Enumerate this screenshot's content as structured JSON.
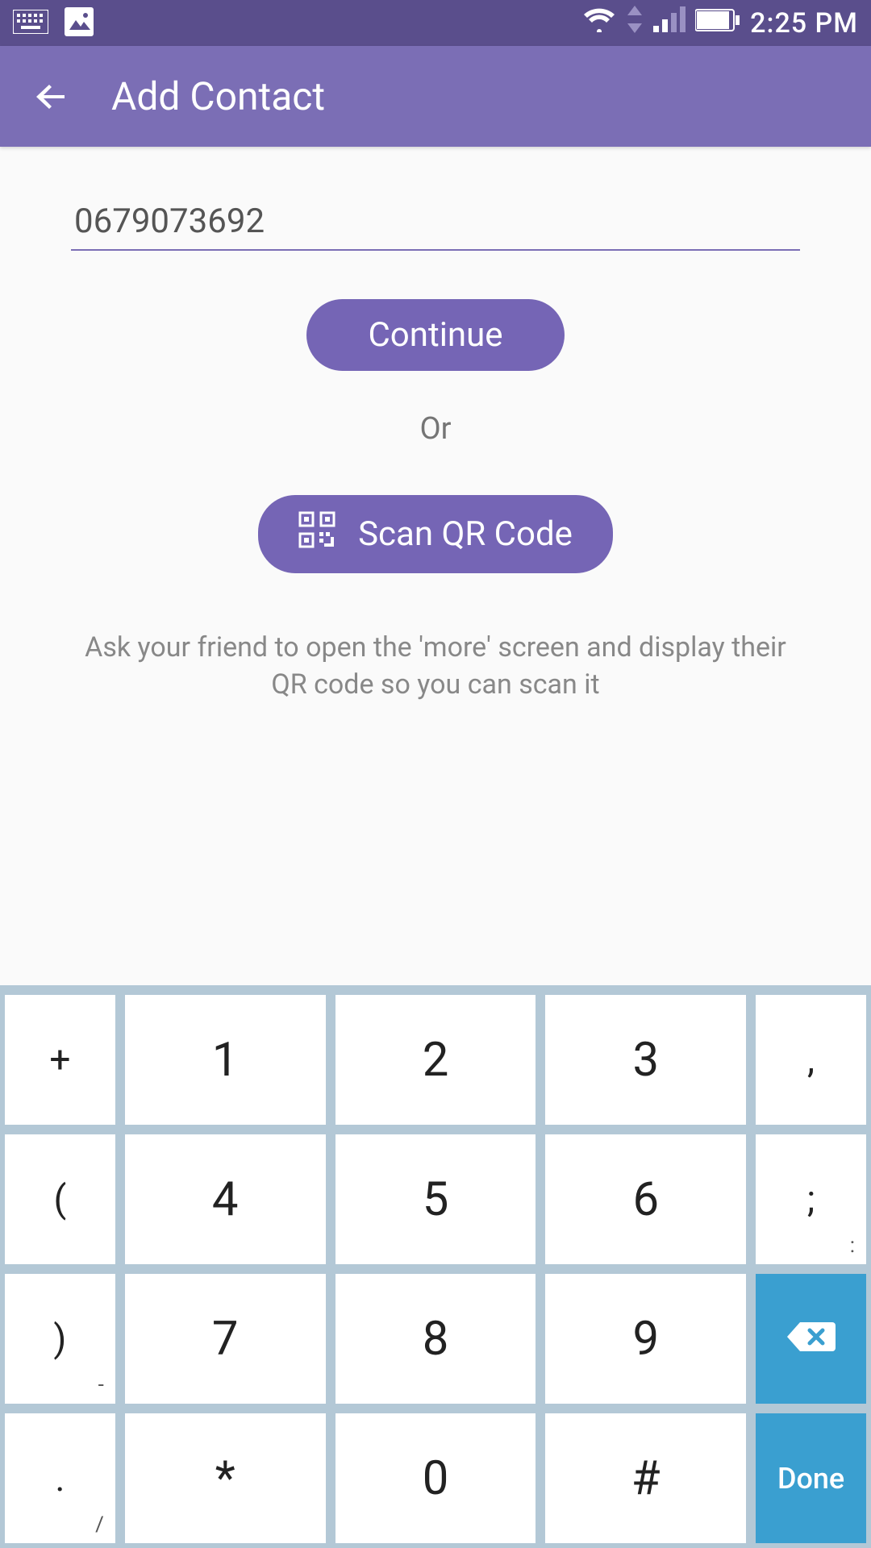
{
  "status": {
    "time": "2:25 PM"
  },
  "header": {
    "title": "Add Contact"
  },
  "main": {
    "phone_value": "0679073692",
    "continue_label": "Continue",
    "or_label": "Or",
    "scan_label": "Scan QR Code",
    "hint": "Ask your friend to open the 'more' screen and display their QR code so you can scan it"
  },
  "keyboard": {
    "rows": [
      [
        {
          "main": "+",
          "small": true
        },
        {
          "main": "1"
        },
        {
          "main": "2"
        },
        {
          "main": "3"
        },
        {
          "main": ",",
          "small": true
        }
      ],
      [
        {
          "main": "(",
          "small": true
        },
        {
          "main": "4"
        },
        {
          "main": "5"
        },
        {
          "main": "6"
        },
        {
          "main": ";",
          "small": true,
          "sub": ":"
        }
      ],
      [
        {
          "main": ")",
          "small": true,
          "sub": "-"
        },
        {
          "main": "7"
        },
        {
          "main": "8"
        },
        {
          "main": "9"
        },
        {
          "type": "backspace",
          "small": true
        }
      ],
      [
        {
          "main": ".",
          "small": true,
          "sub": "/"
        },
        {
          "main": "*"
        },
        {
          "main": "0"
        },
        {
          "main": "#"
        },
        {
          "type": "done",
          "small": true,
          "label": "Done"
        }
      ]
    ]
  }
}
